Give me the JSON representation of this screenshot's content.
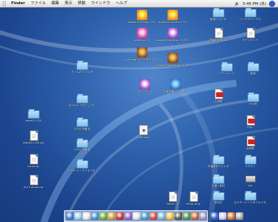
{
  "menubar": {
    "apple": "",
    "items": [
      "Finder",
      "ファイル",
      "編集",
      "表示",
      "移動",
      "ウインドウ",
      "ヘルプ"
    ],
    "clock": "5:46 PM (水)"
  },
  "desktop_icons": [
    {
      "id": "indesign_cs",
      "kind": "app-orange",
      "label": "Adobe InDesign CS3"
    },
    {
      "id": "illustrator_cs",
      "kind": "app-orange",
      "label": "Adobe Illustrator CS3"
    },
    {
      "id": "indesign_cs_short",
      "kind": "app-magenta",
      "label": "InDesign CS"
    },
    {
      "id": "illustrator_cs_alias",
      "kind": "app-purple",
      "label": "Adobe Illustrator CS のエイリアス"
    },
    {
      "id": "indesign_2_alias",
      "kind": "app-brown",
      "label": "InDesign 2.0.2 のエイリアス"
    },
    {
      "id": "photoshop_alias",
      "kind": "app-brown",
      "label": "Adobe Photoshop 7.0 のエイリアス"
    },
    {
      "id": "scrap",
      "kind": "app-purple",
      "label": "ステッカー"
    },
    {
      "id": "compress",
      "kind": "app-blue",
      "label": "写真を縮小して送る"
    },
    {
      "id": "folder_top1",
      "kind": "folder",
      "label": "新規フォルダ"
    },
    {
      "id": "folder_top2",
      "kind": "folder",
      "label": "リンクエイリアス"
    },
    {
      "id": "doc_top1",
      "kind": "doc",
      "label": "会議の記録.txt"
    },
    {
      "id": "doc_top2",
      "kind": "doc",
      "label": "ダウンロード"
    },
    {
      "id": "folder_left1",
      "kind": "folder",
      "label": "ホームのフォルダ"
    },
    {
      "id": "folder_left2",
      "kind": "folder",
      "label": "001003 プロジェクト"
    },
    {
      "id": "folder_left3",
      "kind": "folder",
      "label": "0304 作業用"
    },
    {
      "id": "folder_left4",
      "kind": "folder",
      "label": "0303 作業用"
    },
    {
      "id": "folder_left5",
      "kind": "folder",
      "label": "0304 データフォルダ"
    },
    {
      "id": "folder_far1",
      "kind": "folder",
      "label": "data051128"
    },
    {
      "id": "doc_far2",
      "kind": "doc",
      "label": "data051128.zip"
    },
    {
      "id": "doc_far3",
      "kind": "doc",
      "label": "email.zip"
    },
    {
      "id": "doc_far4",
      "kind": "doc",
      "label": "0413 photo.zip"
    },
    {
      "id": "script_center",
      "kind": "script",
      "label": "Ruler.app"
    },
    {
      "id": "folder_right1",
      "kind": "folder",
      "label": "ドキュメント"
    },
    {
      "id": "folder_right2",
      "kind": "folder",
      "label": "新規"
    },
    {
      "id": "pdf_1",
      "kind": "pdf",
      "label": "企画書"
    },
    {
      "id": "folder_right3",
      "kind": "folder",
      "label": "その他"
    },
    {
      "id": "pdf_2",
      "kind": "pdf",
      "label": "PDF"
    },
    {
      "id": "pdf_3",
      "kind": "pdf",
      "label": "見積書"
    },
    {
      "id": "folder_right4",
      "kind": "folder",
      "label": "共通素材フォルダ"
    },
    {
      "id": "folder_right5",
      "kind": "folder",
      "label": "テキスト"
    },
    {
      "id": "folder_right6",
      "kind": "folder",
      "label": "文書と素材"
    },
    {
      "id": "disk_1",
      "kind": "disk",
      "label": "HD"
    },
    {
      "id": "folder_right7",
      "kind": "folder",
      "label": "保存用"
    },
    {
      "id": "folder_bottom",
      "kind": "folder",
      "label": "旧ドキュメントのフォルダ"
    },
    {
      "id": "doc_bottom1",
      "kind": "doc",
      "label": "Safari1.4"
    },
    {
      "id": "doc_bottom2",
      "kind": "doc",
      "label": "setup.dmg"
    }
  ],
  "dock": {
    "colors": [
      "#3a7bd5",
      "#9ad0f2",
      "#e9e9e9",
      "#4c8fd8",
      "#6fb13a",
      "#d8a23a",
      "#c73232",
      "#8a6ad0",
      "#e5e5e5",
      "#3aa0d8",
      "#d94a4a",
      "#7fb8e8",
      "#f0c040",
      "#5a5a5a",
      "#4a9a4a",
      "#cc6633",
      "#9999cc",
      "#3366cc",
      "#ccccff",
      "#e07a2a",
      "#aaaaaa"
    ]
  }
}
